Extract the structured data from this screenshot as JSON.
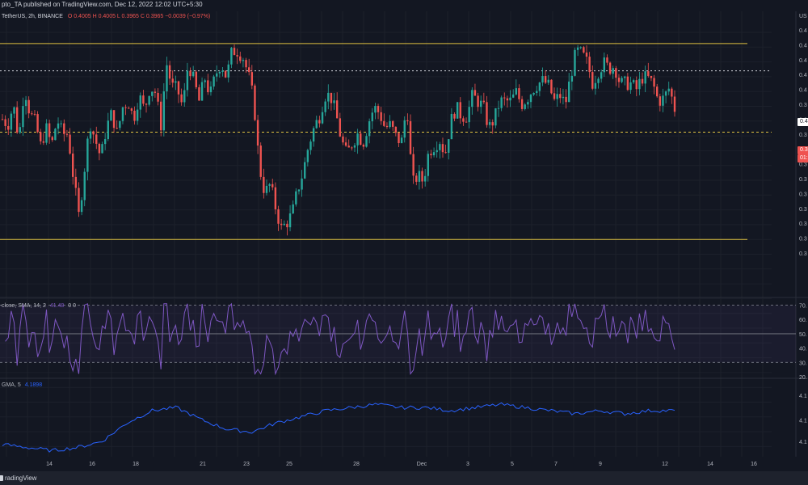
{
  "header": {
    "publisher": "pto_TA published on TradingView.com, Dec 12, 2022 12:02 UTC+5:30"
  },
  "legend_main": {
    "symbol": "TetherUS, 2h, BINANCE",
    "ohlc": "O 0.4005  H 0.4005  L 0.3965  C 0.3965  −0.0039 (−0.97%)"
  },
  "legend_rsi": {
    "label": "close, SMA, 14, 2",
    "value": "41.48",
    "extra": "0  0"
  },
  "legend_obv": {
    "label": "GMA, 5",
    "value": "4.1898"
  },
  "footer": {
    "brand": "radingView"
  },
  "price_tags": {
    "current_a": "0.4",
    "current_b": "0.3",
    "current_c": "01:"
  },
  "axis_right": {
    "top_label": "US",
    "price_ticks": [
      "0.4",
      "0.4",
      "0.4",
      "0.4",
      "0.4",
      "0.3",
      "0.3",
      "0.3",
      "0.3",
      "0.3",
      "0.3",
      "0.3",
      "0.3",
      "0.3",
      "0.3",
      "0.3"
    ],
    "rsi_ticks": [
      "70.",
      "60.",
      "50.",
      "40.",
      "30.",
      "20."
    ],
    "obv_ticks": [
      "4.1",
      "4.1",
      "4.1"
    ]
  },
  "colors": {
    "background": "#131722",
    "up_candle": "#26a69a",
    "down_candle": "#ef5350",
    "resistance_line": "#e0c341",
    "rsi_line": "#7e57c2",
    "obv_line": "#2962ff"
  },
  "chart_data": {
    "type": "candlestick",
    "x_tick_labels": [
      "14",
      "16",
      "18",
      "21",
      "23",
      "25",
      "28",
      "Dec",
      "3",
      "5",
      "7",
      "9",
      "12",
      "14",
      "16"
    ],
    "price_ylim": [
      0.335,
      0.425
    ],
    "levels": [
      {
        "kind": "solid",
        "value": 0.4185
      },
      {
        "kind": "dotted-white",
        "value": 0.4093
      },
      {
        "kind": "dashed",
        "value": 0.3886
      },
      {
        "kind": "solid",
        "value": 0.3524
      }
    ],
    "close_series": [
      0.393,
      0.391,
      0.398,
      0.386,
      0.404,
      0.395,
      0.392,
      0.384,
      0.39,
      0.384,
      0.393,
      0.388,
      0.388,
      0.373,
      0.36,
      0.376,
      0.392,
      0.386,
      0.38,
      0.39,
      0.395,
      0.388,
      0.397,
      0.399,
      0.393,
      0.401,
      0.396,
      0.404,
      0.402,
      0.391,
      0.412,
      0.404,
      0.403,
      0.397,
      0.412,
      0.406,
      0.399,
      0.407,
      0.401,
      0.408,
      0.412,
      0.407,
      0.416,
      0.416,
      0.414,
      0.408,
      0.399,
      0.377,
      0.368,
      0.371,
      0.363,
      0.356,
      0.358,
      0.361,
      0.369,
      0.375,
      0.384,
      0.39,
      0.394,
      0.401,
      0.401,
      0.395,
      0.386,
      0.381,
      0.385,
      0.388,
      0.385,
      0.392,
      0.397,
      0.395,
      0.39,
      0.391,
      0.387,
      0.385,
      0.398,
      0.371,
      0.374,
      0.372,
      0.382,
      0.384,
      0.386,
      0.381,
      0.392,
      0.397,
      0.394,
      0.394,
      0.401,
      0.399,
      0.397,
      0.39,
      0.393,
      0.399,
      0.399,
      0.399,
      0.402,
      0.398,
      0.4,
      0.403,
      0.405,
      0.406,
      0.404,
      0.399,
      0.401,
      0.398,
      0.408,
      0.416,
      0.415,
      0.412,
      0.405,
      0.409,
      0.412,
      0.41,
      0.411,
      0.405,
      0.405,
      0.405,
      0.403,
      0.407,
      0.407,
      0.405,
      0.399,
      0.4,
      0.4035,
      0.3965
    ],
    "rsi": {
      "levels": [
        70,
        50,
        30
      ],
      "ylim": [
        20,
        72
      ],
      "last": 41.48
    },
    "obv": {
      "ylim": [
        4.0,
        4.25
      ],
      "last": 4.1898
    }
  }
}
